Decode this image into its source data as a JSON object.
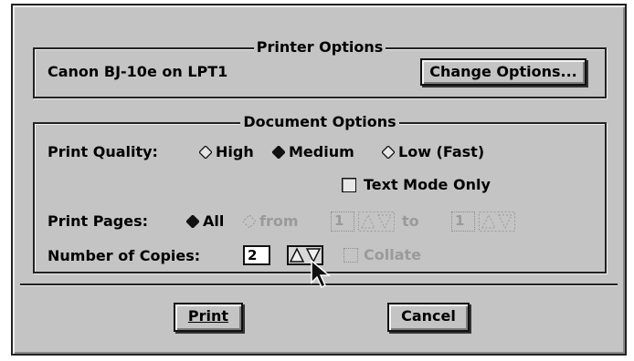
{
  "printer_options": {
    "legend": "Printer Options",
    "printer_name": "Canon BJ-10e on LPT1",
    "change_button": "Change Options..."
  },
  "document_options": {
    "legend": "Document Options",
    "print_quality": {
      "label": "Print Quality:",
      "options": [
        "High",
        "Medium",
        "Low (Fast)"
      ],
      "selected": "Medium"
    },
    "text_mode_only": {
      "label": "Text Mode Only",
      "checked": false
    },
    "print_pages": {
      "label": "Print Pages:",
      "all_label": "All",
      "from_label": "from",
      "to_label": "to",
      "from_value": "1",
      "to_value": "1",
      "selected": "All"
    },
    "copies": {
      "label": "Number of Copies:",
      "value": "2",
      "collate_label": "Collate",
      "collate_checked": false
    }
  },
  "buttons": {
    "print": "Print",
    "cancel": "Cancel"
  },
  "icons": [
    "radio-diamond-icon",
    "spinner-arrows-icon",
    "mouse-cursor-icon"
  ],
  "colors": {
    "dialog_background": "#c4c4c4",
    "frame": "#222222",
    "disabled_text": "#9a9a9a"
  }
}
